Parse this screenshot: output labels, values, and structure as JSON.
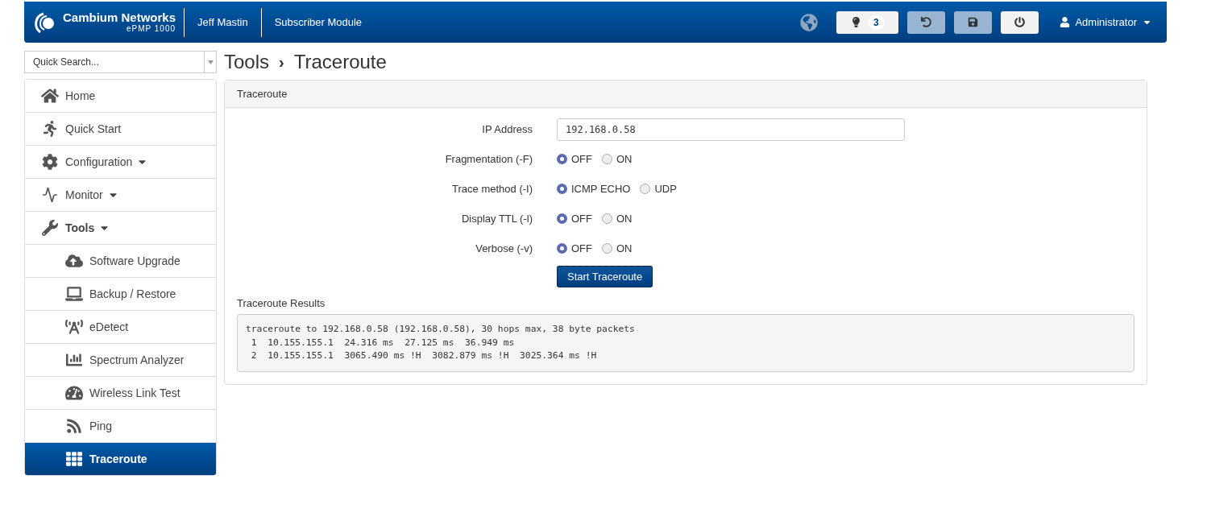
{
  "header": {
    "brand": "Cambium Networks",
    "model": "ePMP 1000",
    "device_name": "Jeff Mastin",
    "mode": "Subscriber Module",
    "alerts_count": "3",
    "user": "Administrator"
  },
  "quick_search": {
    "placeholder": "Quick Search..."
  },
  "breadcrumb": {
    "section": "Tools",
    "separator": "›",
    "page": "Traceroute"
  },
  "sidebar": {
    "items": [
      {
        "label": "Home",
        "caret": false,
        "current": false,
        "selected": false
      },
      {
        "label": "Quick Start",
        "caret": false,
        "current": false,
        "selected": false
      },
      {
        "label": "Configuration",
        "caret": true,
        "current": false,
        "selected": false
      },
      {
        "label": "Monitor",
        "caret": true,
        "current": false,
        "selected": false
      },
      {
        "label": "Tools",
        "caret": true,
        "current": true,
        "selected": false,
        "children": [
          {
            "label": "Software Upgrade",
            "selected": false
          },
          {
            "label": "Backup / Restore",
            "selected": false
          },
          {
            "label": "eDetect",
            "selected": false
          },
          {
            "label": "Spectrum Analyzer",
            "selected": false
          },
          {
            "label": "Wireless Link Test",
            "selected": false
          },
          {
            "label": "Ping",
            "selected": false
          },
          {
            "label": "Traceroute",
            "selected": true
          }
        ]
      }
    ]
  },
  "panel": {
    "title": "Traceroute",
    "ip_address": {
      "label": "IP Address",
      "value": "192.168.0.58"
    },
    "options": [
      {
        "label": "Fragmentation (-F)",
        "choices": [
          {
            "label": "OFF",
            "selected": true
          },
          {
            "label": "ON",
            "selected": false
          }
        ]
      },
      {
        "label": "Trace method (-I)",
        "choices": [
          {
            "label": "ICMP ECHO",
            "selected": true
          },
          {
            "label": "UDP",
            "selected": false
          }
        ]
      },
      {
        "label": "Display TTL (-l)",
        "choices": [
          {
            "label": "OFF",
            "selected": true
          },
          {
            "label": "ON",
            "selected": false
          }
        ]
      },
      {
        "label": "Verbose (-v)",
        "choices": [
          {
            "label": "OFF",
            "selected": true
          },
          {
            "label": "ON",
            "selected": false
          }
        ]
      }
    ],
    "start_button": "Start Traceroute",
    "results_label": "Traceroute Results",
    "results": [
      "traceroute to 192.168.0.58 (192.168.0.58), 30 hops max, 38 byte packets",
      " 1  10.155.155.1  24.316 ms  27.125 ms  36.949 ms",
      " 2  10.155.155.1  3065.490 ms !H  3082.879 ms !H  3025.364 ms !H"
    ]
  }
}
